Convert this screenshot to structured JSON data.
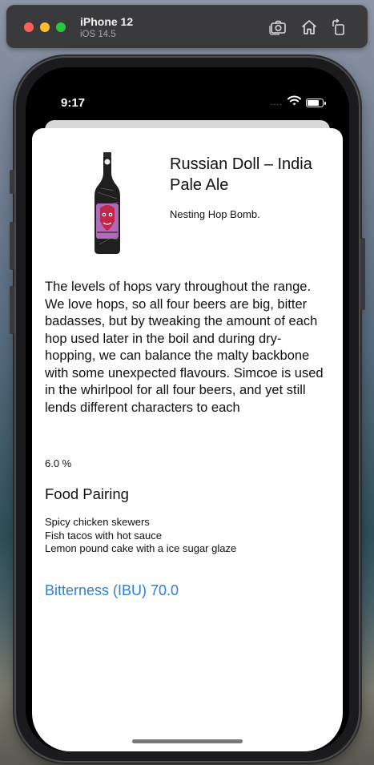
{
  "simulator": {
    "device_name": "iPhone 12",
    "os_version": "iOS 14.5",
    "toolbar_icons": [
      "screenshot-icon",
      "home-icon",
      "rotate-icon"
    ]
  },
  "status_bar": {
    "time": "9:17",
    "signal": "....",
    "battery_level": 0.85
  },
  "beer": {
    "name": "Russian Doll – India Pale Ale",
    "tagline": "Nesting Hop Bomb.",
    "description": "The levels of hops vary throughout the range. We love hops, so all four beers are big, bitter badasses, but by tweaking the amount of each hop used later in the boil and during dry- hopping, we can balance the malty backbone with some unexpected flavours. Simcoe is used in the whirlpool for all four beers, and yet still lends different characters to each",
    "abv": "6.0 %",
    "food_pairing_title": "Food Pairing",
    "food_pairing": [
      "Spicy chicken skewers",
      "Fish tacos with hot sauce",
      "Lemon pound cake with a ice sugar glaze"
    ],
    "ibu_label": "Bitterness (IBU) 70.0"
  },
  "colors": {
    "accent": "#2f7fd3",
    "bottle_label": "#b06ab8",
    "bottle_face": "#c2274a"
  }
}
